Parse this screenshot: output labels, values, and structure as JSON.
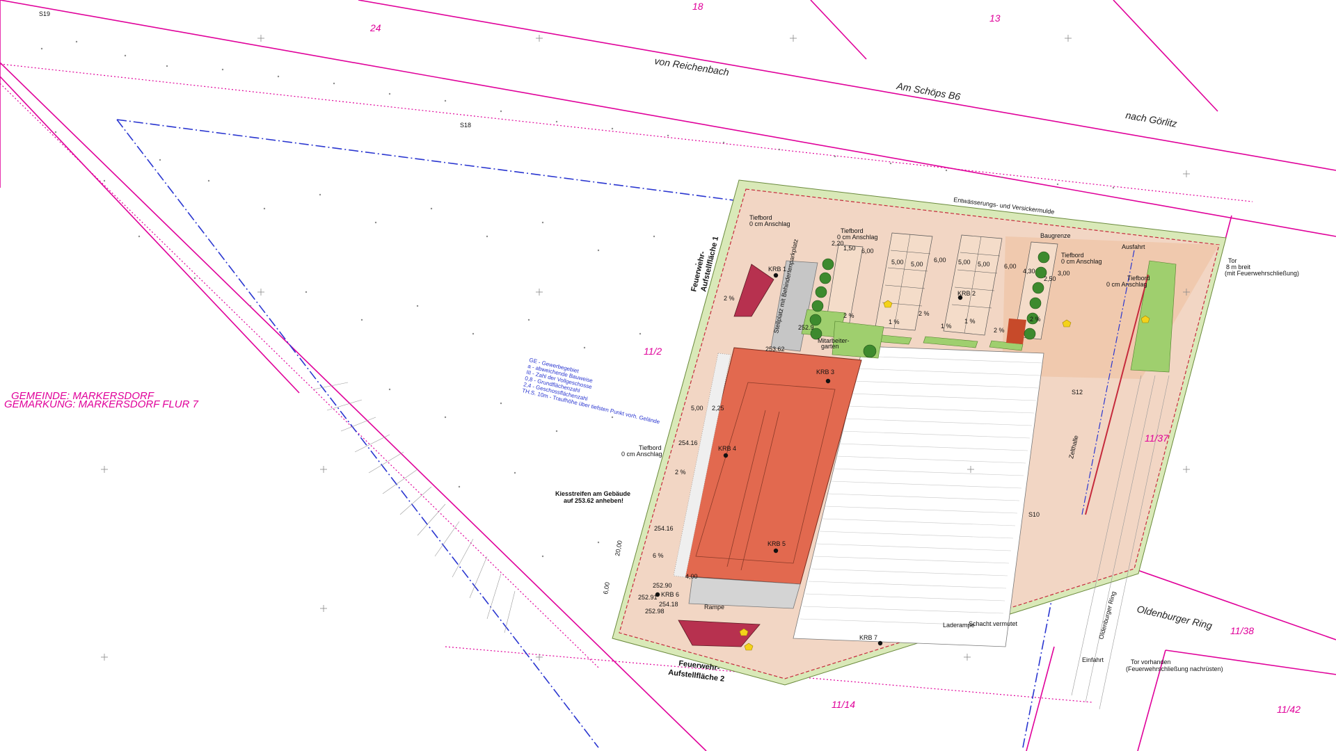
{
  "parcels": [
    "18",
    "13",
    "24",
    "11/2",
    "11/37",
    "11/38",
    "11/14",
    "11/42"
  ],
  "streets": [
    "von Reichenbach",
    "Am Schöps  B6",
    "nach Görlitz",
    "Oldenburger Ring",
    "Oldenburger Ring"
  ],
  "municipality": [
    "GEMEINDE: MARKERSDORF",
    "GEMARKUNG: MARKERSDORF FLUR 7"
  ],
  "legend": [
    "GE - Gewerbegebiet",
    "a - abweichende Bauweise",
    "III - Zahl der Vollgeschosse",
    "0,8 - Grundflächenzahl",
    "2,4 - Geschossflächenzahl",
    "TH.S. 10m - Traufhöhe über tiefsten Punkt vorh. Gelände"
  ],
  "labels": {
    "fw1": "Feuerwehr-",
    "fw1b": "Aufstellfläche 1",
    "fw2": "Feuerwehr-",
    "fw2b": "Aufstellfläche 2",
    "mulde": "Entwässerungs- und Versickermulde",
    "baugrenze": "Baugrenze",
    "ausfahrt": "Ausfahrt",
    "tor": "Tor",
    "tor2": "8 m breit",
    "tor3": "(mit Feuerwehrschließung)",
    "tiefbord1": "Tiefbord",
    "tiefbord1b": "0 cm Anschlag",
    "tiefbord2": "Tiefbord",
    "tiefbord2b": "0 cm Anschlag",
    "tiefbord3": "Tiefbord",
    "tiefbord3b": "0 cm Anschlag",
    "tiefbord4": "Tiefbord",
    "tiefbord4b": "0 cm Anschlag",
    "tiefbord5": "Tiefbord",
    "tiefbord5b": "0 cm Anschlag",
    "kies1": "Kiesstreifen am Gebäude",
    "kies2": "auf 253.62 anheben!",
    "mieter1": "Mitarbeiter-",
    "mieter2": "garten",
    "zelthalle": "Zelthalle",
    "laderampe": "Laderampe",
    "rampe": "Rampe",
    "einfahrt": "Einfahrt",
    "torvh": "Tor vorhanden",
    "torvh2": "(Feuerwehrschließung nachrüsten)",
    "schacht": "Schacht vermutet",
    "stellplatz": "Stellplatz mit Behindertenparkplatz"
  },
  "krb": [
    "KRB 1",
    "KRB 2",
    "KRB 3",
    "KRB 4",
    "KRB 5",
    "KRB 6",
    "KRB 7"
  ],
  "dims": [
    "2,20",
    "1,50",
    "6,00",
    "5,00",
    "5,00",
    "6,00",
    "5,00",
    "5,00",
    "6,00",
    "4,30",
    "3,00",
    "2,50",
    "5,00",
    "2,25",
    "4,00",
    "20,00",
    "6,00"
  ],
  "slopes": [
    "2 %",
    "2 %",
    "1 %",
    "2 %",
    "1 %",
    "2 %",
    "1 %",
    "2 %",
    "6 %",
    "2 %"
  ],
  "heights": [
    "252.9",
    "254.16",
    "254.16",
    "252.90",
    "252.91",
    "254.18",
    "252.98",
    "253.62"
  ],
  "points": [
    "S19",
    "S18",
    "S12",
    "S10"
  ],
  "colors": {
    "parcel_line": "#e0009a",
    "building": "#e2694f",
    "paving": "#f0c9ae",
    "green": "#b9d98e",
    "tree": "#3d8a2e",
    "roof_red": "#b7314f",
    "blue_line": "#2a36d0"
  }
}
